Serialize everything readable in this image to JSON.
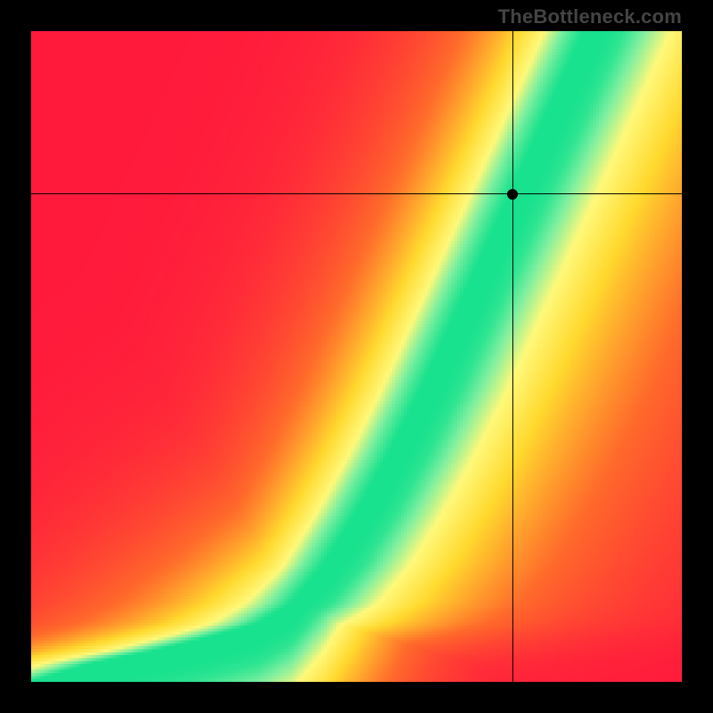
{
  "attribution": "TheBottleneck.com",
  "chart_data": {
    "type": "heatmap",
    "title": "",
    "xlabel": "",
    "ylabel": "",
    "xlim": [
      0,
      100
    ],
    "ylim": [
      0,
      100
    ],
    "crosshair": {
      "x": 74,
      "y": 75
    },
    "optimal_curve": {
      "comment": "y = f(x) defining the green ridge (optimal match line) in normalized 0-100 coords",
      "points": [
        {
          "x": 0,
          "y": 0
        },
        {
          "x": 10,
          "y": 3
        },
        {
          "x": 20,
          "y": 5
        },
        {
          "x": 28,
          "y": 7
        },
        {
          "x": 35,
          "y": 9
        },
        {
          "x": 40,
          "y": 12
        },
        {
          "x": 45,
          "y": 18
        },
        {
          "x": 50,
          "y": 26
        },
        {
          "x": 55,
          "y": 35
        },
        {
          "x": 60,
          "y": 45
        },
        {
          "x": 65,
          "y": 56
        },
        {
          "x": 70,
          "y": 67
        },
        {
          "x": 75,
          "y": 78
        },
        {
          "x": 80,
          "y": 89
        },
        {
          "x": 85,
          "y": 100
        }
      ]
    },
    "colorscale": {
      "comment": "value 0 = far from optimal (red), 1 = on optimal (green); intermediate via orange/yellow",
      "stops": [
        {
          "v": 0.0,
          "color": "#ff1a3c"
        },
        {
          "v": 0.35,
          "color": "#ff6a2b"
        },
        {
          "v": 0.65,
          "color": "#ffd92e"
        },
        {
          "v": 0.82,
          "color": "#fff97a"
        },
        {
          "v": 0.92,
          "color": "#7ff0a0"
        },
        {
          "v": 1.0,
          "color": "#18e28e"
        }
      ]
    },
    "ridge_width": 6,
    "falloff_right_scale": 45,
    "falloff_left_scale": 28,
    "crosshair_value_estimate": 0.85
  }
}
